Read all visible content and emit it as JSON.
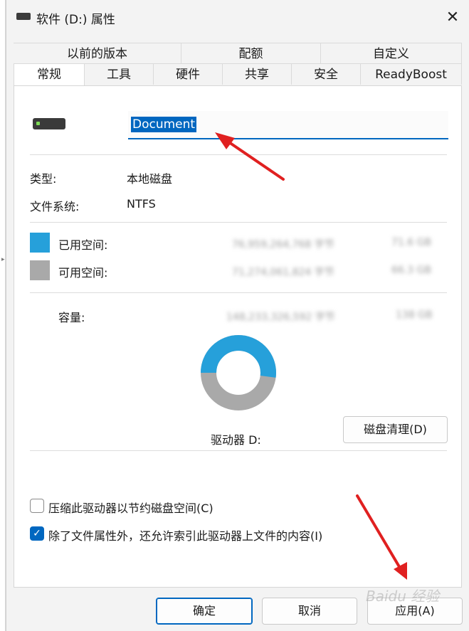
{
  "window": {
    "title": "软件 (D:) 属性",
    "close_glyph": "✕"
  },
  "tabs_row1": [
    {
      "label": "以前的版本"
    },
    {
      "label": "配额"
    },
    {
      "label": "自定义"
    }
  ],
  "tabs_row2": [
    {
      "label": "常规",
      "active": true
    },
    {
      "label": "工具"
    },
    {
      "label": "硬件"
    },
    {
      "label": "共享"
    },
    {
      "label": "安全"
    },
    {
      "label": "ReadyBoost"
    }
  ],
  "general": {
    "volume_name": "Document",
    "type_label": "类型:",
    "type_value": "本地磁盘",
    "fs_label": "文件系统:",
    "fs_value": "NTFS",
    "used_label": "已用空间:",
    "used_bytes": "76,959,264,768 字节",
    "used_size": "71.6 GB",
    "free_label": "可用空间:",
    "free_bytes": "71,274,061,824 字节",
    "free_size": "66.3 GB",
    "capacity_label": "容量:",
    "capacity_bytes": "148,233,326,592 字节",
    "capacity_size": "138 GB",
    "drive_label": "驱动器 D:",
    "cleanup_button": "磁盘清理(D)",
    "used_fraction": 0.52,
    "compress_label": "压缩此驱动器以节约磁盘空间(C)",
    "compress_checked": false,
    "index_label": "除了文件属性外，还允许索引此驱动器上文件的内容(I)",
    "index_checked": true
  },
  "footer": {
    "ok": "确定",
    "cancel": "取消",
    "apply": "应用(A)"
  },
  "colors": {
    "used": "#26a0da",
    "free": "#a9a9a9",
    "accent": "#0067c0",
    "annotation_arrow": "#e02020"
  },
  "watermark": "Baidu 经验"
}
